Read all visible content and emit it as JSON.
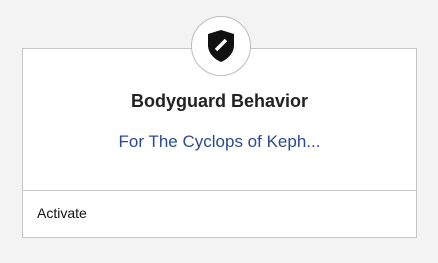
{
  "card": {
    "title": "Bodyguard Behavior",
    "subtitle": "For The Cyclops of Keph...",
    "action_label": "Activate",
    "icon": "shield-icon"
  },
  "colors": {
    "background": "#f3f3f3",
    "card_border": "#c6c6c6",
    "title": "#222222",
    "subtitle": "#2b4c8c"
  }
}
